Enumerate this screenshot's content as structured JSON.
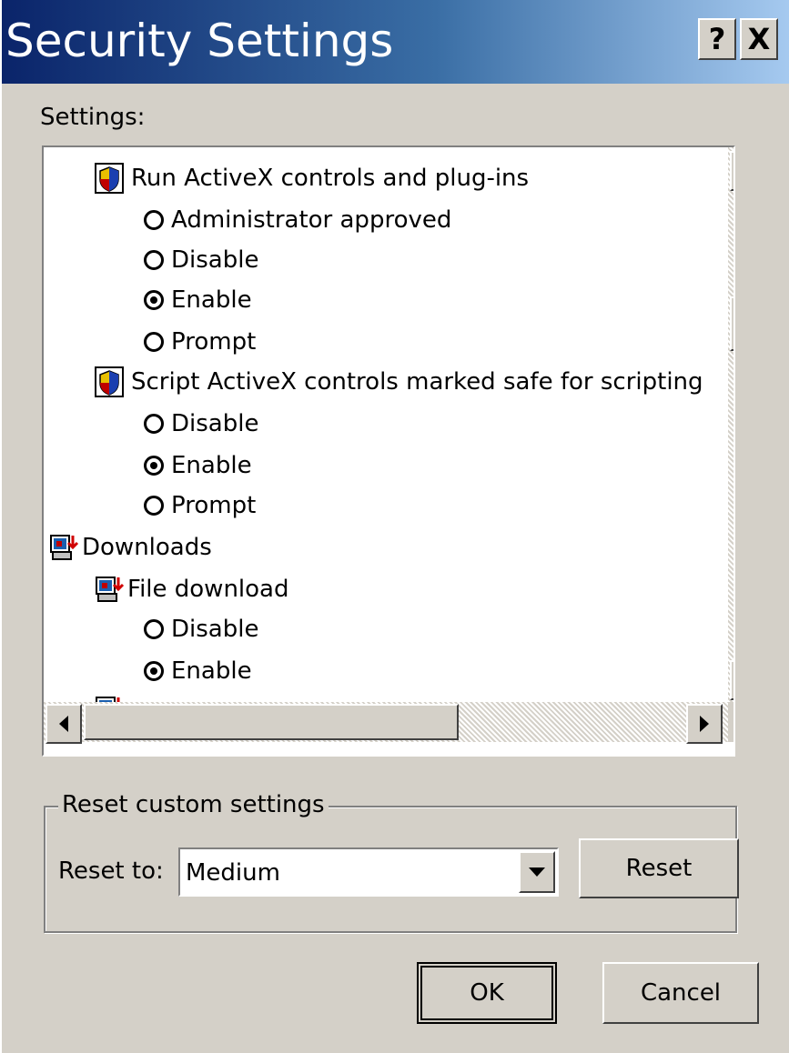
{
  "window": {
    "title": "Security Settings",
    "help_label": "?",
    "close_label": "X"
  },
  "settings_label": "Settings:",
  "settings_list": {
    "groups": [
      {
        "label": "Run ActiveX controls and plug-ins",
        "icon": "shield-icon",
        "options": [
          {
            "label": "Administrator approved",
            "selected": false
          },
          {
            "label": "Disable",
            "selected": false
          },
          {
            "label": "Enable",
            "selected": true
          },
          {
            "label": "Prompt",
            "selected": false
          }
        ]
      },
      {
        "label": "Script ActiveX controls marked safe for scripting",
        "icon": "shield-icon",
        "options": [
          {
            "label": "Disable",
            "selected": false
          },
          {
            "label": "Enable",
            "selected": true
          },
          {
            "label": "Prompt",
            "selected": false
          }
        ]
      }
    ],
    "category": {
      "label": "Downloads",
      "icon": "download-icon"
    },
    "subgroups": [
      {
        "label": "File download",
        "icon": "download-icon",
        "options": [
          {
            "label": "Disable",
            "selected": false
          },
          {
            "label": "Enable",
            "selected": true
          }
        ]
      }
    ]
  },
  "reset_group": {
    "legend": "Reset custom settings",
    "reset_to_label": "Reset to:",
    "selected_level": "Medium",
    "reset_button": "Reset"
  },
  "footer": {
    "ok_label": "OK",
    "cancel_label": "Cancel"
  },
  "colors": {
    "titlebar_start": "#0a246a",
    "titlebar_end": "#a6caf0",
    "dialog_bg": "#d4d0c8"
  }
}
